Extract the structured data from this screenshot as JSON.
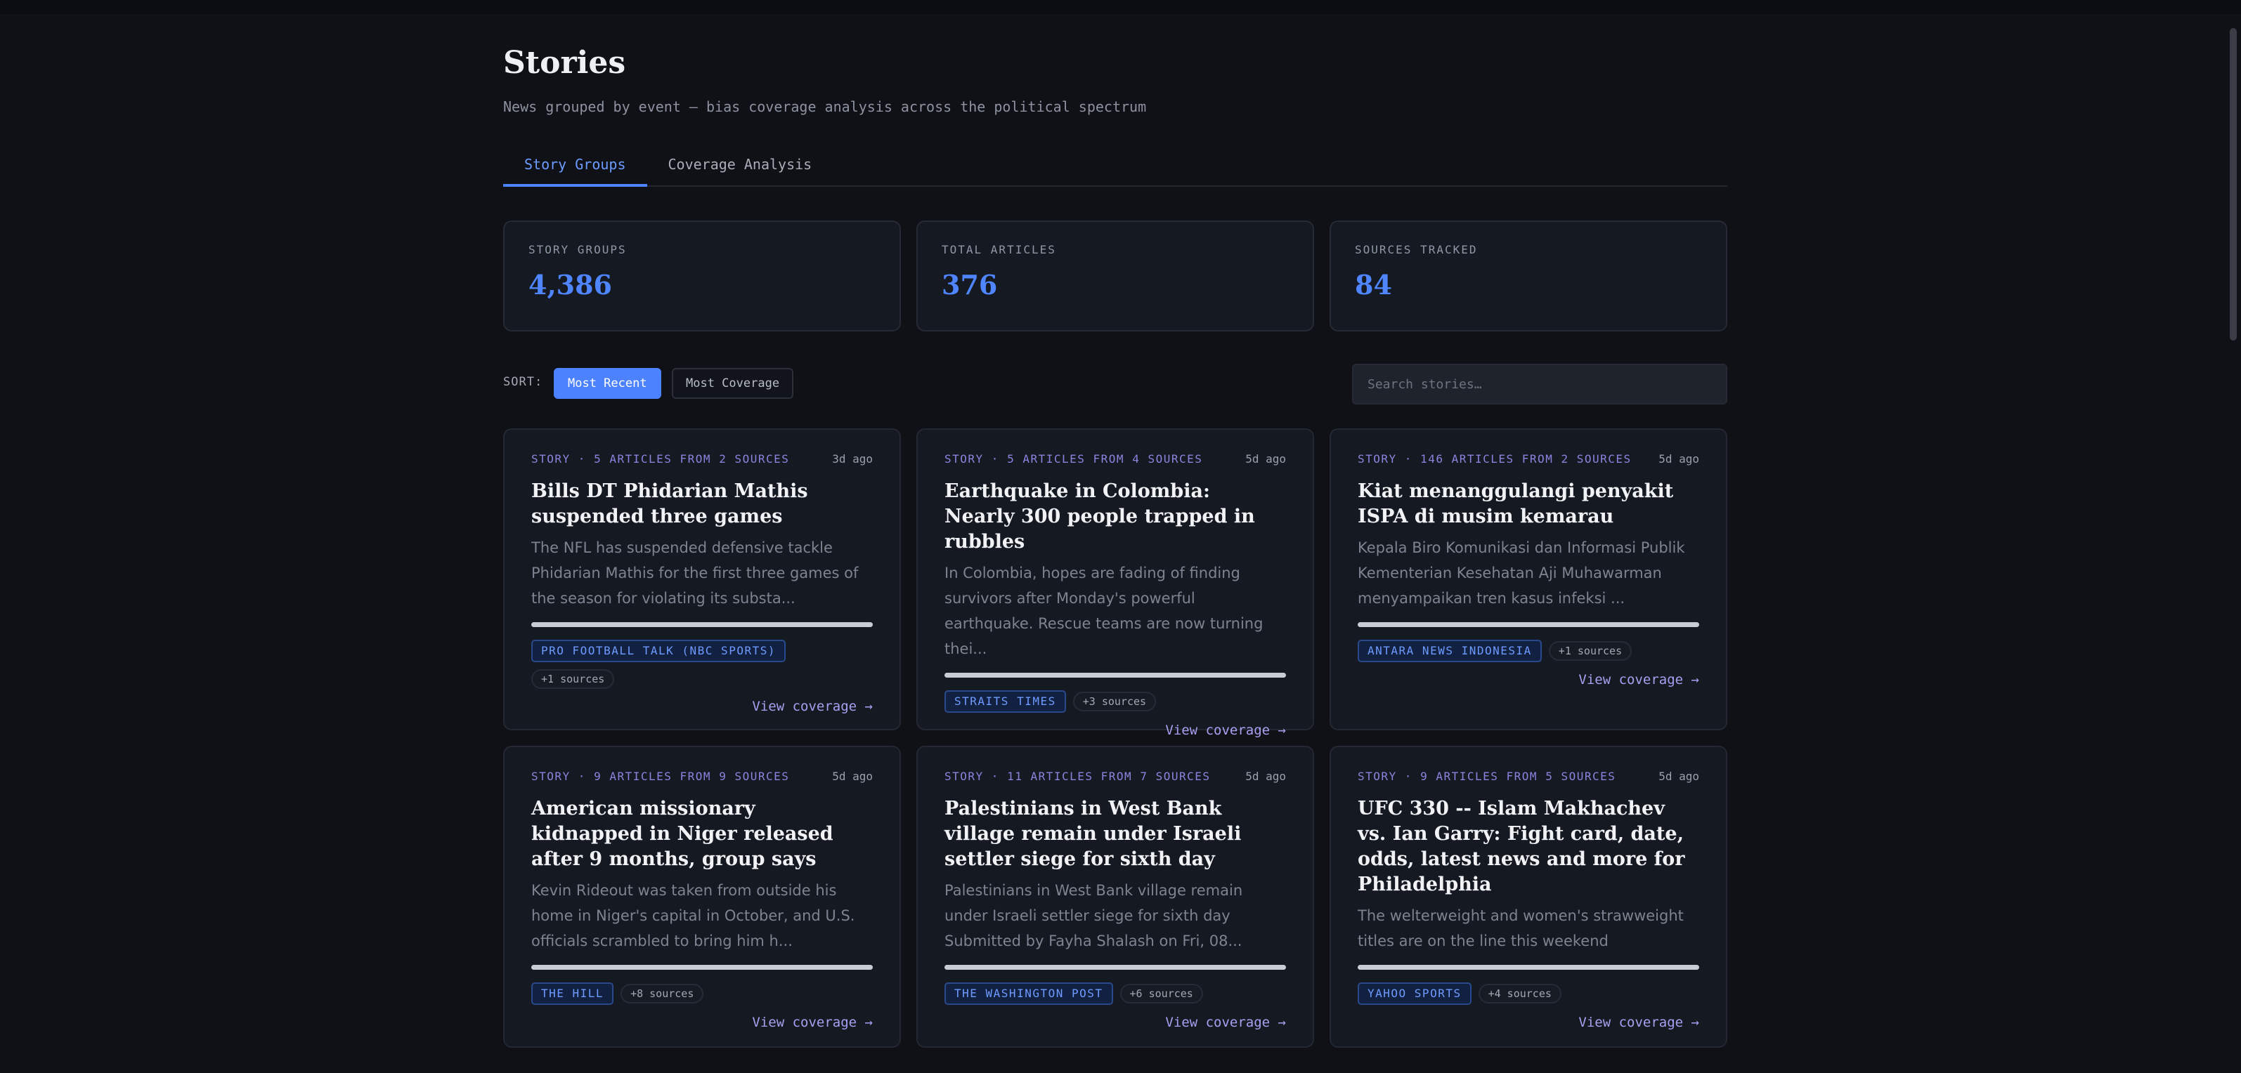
{
  "header": {
    "title": "Stories",
    "subtitle": "News grouped by event — bias coverage analysis across the political spectrum"
  },
  "tabs": [
    {
      "label": "Story Groups",
      "active": true
    },
    {
      "label": "Coverage Analysis",
      "active": false
    }
  ],
  "stats": [
    {
      "label": "STORY GROUPS",
      "value": "4,386"
    },
    {
      "label": "TOTAL ARTICLES",
      "value": "376"
    },
    {
      "label": "SOURCES TRACKED",
      "value": "84"
    }
  ],
  "controls": {
    "sort_label": "SORT:",
    "sort_options": [
      "Most Recent",
      "Most Coverage"
    ],
    "selected_sort": "Most Recent",
    "search_placeholder": "Search stories…"
  },
  "colors": {
    "accent": "#4d82ff",
    "meta": "#8d83df",
    "background": "#0f1117"
  },
  "cards": [
    {
      "meta": "STORY · 5 ARTICLES FROM 2 SOURCES",
      "age": "3d ago",
      "title": "Bills DT Phidarian Mathis suspended three games",
      "summary": "The NFL has suspended defensive tackle Phidarian Mathis for the first three games of the season for violating its substa...",
      "source": "PRO FOOTBALL TALK (NBC SPORTS)",
      "more": "+1 sources",
      "link": "View coverage →"
    },
    {
      "meta": "STORY · 5 ARTICLES FROM 4 SOURCES",
      "age": "5d ago",
      "title": "Earthquake in Colombia: Nearly 300 people trapped in rubbles",
      "summary": "In Colombia, hopes are fading of finding survivors after Monday's powerful earthquake. Rescue teams are now turning thei...",
      "source": "STRAITS TIMES",
      "more": "+3 sources",
      "link": "View coverage →"
    },
    {
      "meta": "STORY · 146 ARTICLES FROM 2 SOURCES",
      "age": "5d ago",
      "title": "Kiat menanggulangi penyakit ISPA di musim kemarau",
      "summary": "Kepala Biro Komunikasi dan Informasi Publik Kementerian Kesehatan Aji Muhawarman menyampaikan tren kasus infeksi ...",
      "source": "ANTARA NEWS INDONESIA",
      "more": "+1 sources",
      "link": "View coverage →"
    },
    {
      "meta": "STORY · 9 ARTICLES FROM 9 SOURCES",
      "age": "5d ago",
      "title": "American missionary kidnapped in Niger released after 9 months, group says",
      "summary": "Kevin Rideout was taken from outside his home in Niger's capital in October, and U.S. officials scrambled to bring him h...",
      "source": "THE HILL",
      "more": "+8 sources",
      "link": "View coverage →"
    },
    {
      "meta": "STORY · 11 ARTICLES FROM 7 SOURCES",
      "age": "5d ago",
      "title": "Palestinians in West Bank village remain under Israeli settler siege for sixth day",
      "summary": "Palestinians in West Bank village remain under Israeli settler siege for sixth day Submitted by Fayha Shalash on Fri, 08...",
      "source": "THE WASHINGTON POST",
      "more": "+6 sources",
      "link": "View coverage →"
    },
    {
      "meta": "STORY · 9 ARTICLES FROM 5 SOURCES",
      "age": "5d ago",
      "title": "UFC 330 -- Islam Makhachev vs. Ian Garry: Fight card, date, odds, latest news and more for Philadelphia",
      "summary": "The welterweight and women's strawweight titles are on the line this weekend",
      "source": "YAHOO SPORTS",
      "more": "+4 sources",
      "link": "View coverage →"
    }
  ]
}
